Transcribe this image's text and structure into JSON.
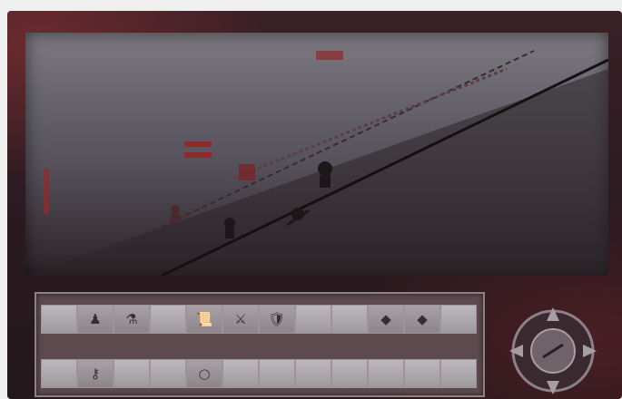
{
  "game": {
    "view": {
      "title": "",
      "entities": [
        {
          "name": "enemy-figure",
          "icon": "humanoid-icon",
          "color": "#1e1719"
        },
        {
          "name": "enemy-figure",
          "icon": "humanoid-icon",
          "color": "#1e1719"
        },
        {
          "name": "enemy-figure",
          "icon": "humanoid-icon",
          "color": "#1e1719"
        },
        {
          "name": "enemy-figure",
          "icon": "humanoid-icon",
          "color": "#1e1719"
        },
        {
          "name": "red-banner",
          "icon": "banner-icon",
          "color": "#8e2a2d"
        }
      ]
    },
    "hotbar": {
      "slots": [
        {
          "icon": "empty-slot-icon",
          "glyph": ""
        },
        {
          "icon": "figure-icon",
          "glyph": "♟"
        },
        {
          "icon": "potion-icon",
          "glyph": "⚗"
        },
        {
          "icon": "empty-slot-icon",
          "glyph": ""
        },
        {
          "icon": "scroll-icon",
          "glyph": "📜"
        },
        {
          "icon": "weapon-icon",
          "glyph": "⚔"
        },
        {
          "icon": "shield-icon",
          "glyph": "🛡"
        },
        {
          "icon": "empty-slot-icon",
          "glyph": ""
        },
        {
          "icon": "empty-slot-icon",
          "glyph": ""
        },
        {
          "icon": "gem-icon",
          "glyph": "◆"
        },
        {
          "icon": "gem-icon",
          "glyph": "◆"
        },
        {
          "icon": "empty-slot-icon",
          "glyph": ""
        },
        {
          "icon": "empty-slot-icon",
          "glyph": ""
        },
        {
          "icon": "key-icon",
          "glyph": "⚷"
        },
        {
          "icon": "empty-slot-icon",
          "glyph": ""
        },
        {
          "icon": "empty-slot-icon",
          "glyph": ""
        },
        {
          "icon": "ring-icon",
          "glyph": "○"
        },
        {
          "icon": "empty-slot-icon",
          "glyph": ""
        },
        {
          "icon": "empty-slot-icon",
          "glyph": ""
        },
        {
          "icon": "empty-slot-icon",
          "glyph": ""
        },
        {
          "icon": "empty-slot-icon",
          "glyph": ""
        },
        {
          "icon": "empty-slot-icon",
          "glyph": ""
        },
        {
          "icon": "empty-slot-icon",
          "glyph": ""
        },
        {
          "icon": "empty-slot-icon",
          "glyph": ""
        }
      ]
    },
    "compass": {
      "icon": "compass-icon",
      "directions": [
        "N",
        "E",
        "S",
        "W"
      ]
    },
    "colors": {
      "frame": "#3a2026",
      "accent": "#8e2a2d",
      "panel": "#5c4a4e"
    }
  }
}
